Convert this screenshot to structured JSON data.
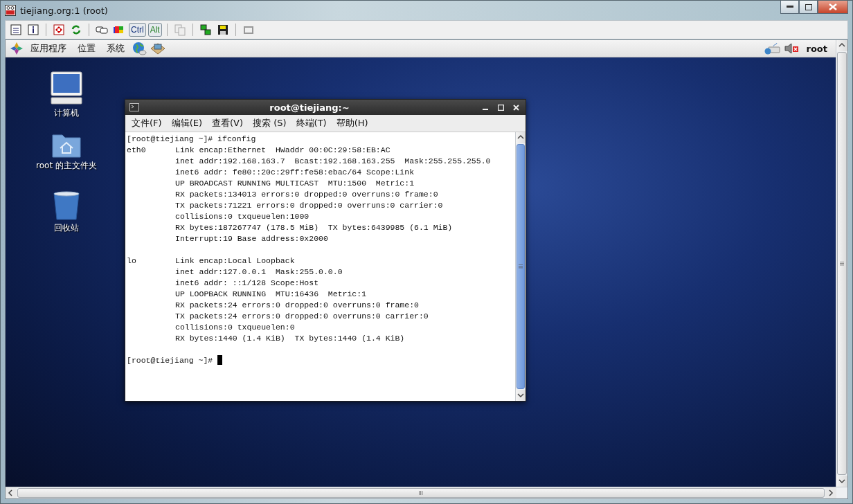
{
  "window": {
    "title": "tiejiang.org:1 (root)"
  },
  "toolbar": {
    "keys": [
      "Ctrl",
      "Alt"
    ]
  },
  "panel": {
    "menus": [
      "应用程序",
      "位置",
      "系统"
    ],
    "user": "root"
  },
  "desktop_icons": [
    {
      "kind": "computer",
      "label": "计算机"
    },
    {
      "kind": "home",
      "label": "root 的主文件夹"
    },
    {
      "kind": "trash",
      "label": "回收站"
    }
  ],
  "terminal": {
    "title": "root@tiejiang:~",
    "menus": [
      "文件(F)",
      "编辑(E)",
      "查看(V)",
      "搜索 (S)",
      "终端(T)",
      "帮助(H)"
    ],
    "lines": [
      {
        "kind": "prompt",
        "text": "[root@tiejiang ~]# ifconfig"
      },
      {
        "kind": "entry",
        "label": "eth0",
        "text": "Link encap:Ethernet  HWaddr 00:0C:29:58:EB:AC"
      },
      {
        "kind": "entry",
        "text": "inet addr:192.168.163.7  Bcast:192.168.163.255  Mask:255.255.255.0"
      },
      {
        "kind": "entry",
        "text": "inet6 addr: fe80::20c:29ff:fe58:ebac/64 Scope:Link"
      },
      {
        "kind": "entry",
        "text": "UP BROADCAST RUNNING MULTICAST  MTU:1500  Metric:1"
      },
      {
        "kind": "entry",
        "text": "RX packets:134013 errors:0 dropped:0 overruns:0 frame:0"
      },
      {
        "kind": "entry",
        "text": "TX packets:71221 errors:0 dropped:0 overruns:0 carrier:0"
      },
      {
        "kind": "entry",
        "text": "collisions:0 txqueuelen:1000"
      },
      {
        "kind": "entry",
        "text": "RX bytes:187267747 (178.5 MiB)  TX bytes:6439985 (6.1 MiB)"
      },
      {
        "kind": "entry",
        "text": "Interrupt:19 Base address:0x2000"
      },
      {
        "kind": "blank"
      },
      {
        "kind": "entry",
        "label": "lo",
        "text": "Link encap:Local Loopback"
      },
      {
        "kind": "entry",
        "text": "inet addr:127.0.0.1  Mask:255.0.0.0"
      },
      {
        "kind": "entry",
        "text": "inet6 addr: ::1/128 Scope:Host"
      },
      {
        "kind": "entry",
        "text": "UP LOOPBACK RUNNING  MTU:16436  Metric:1"
      },
      {
        "kind": "entry",
        "text": "RX packets:24 errors:0 dropped:0 overruns:0 frame:0"
      },
      {
        "kind": "entry",
        "text": "TX packets:24 errors:0 dropped:0 overruns:0 carrier:0"
      },
      {
        "kind": "entry",
        "text": "collisions:0 txqueuelen:0"
      },
      {
        "kind": "entry",
        "text": "RX bytes:1440 (1.4 KiB)  TX bytes:1440 (1.4 KiB)"
      },
      {
        "kind": "blank"
      },
      {
        "kind": "prompt",
        "text": "[root@tiejiang ~]#",
        "cursor": true
      }
    ]
  }
}
